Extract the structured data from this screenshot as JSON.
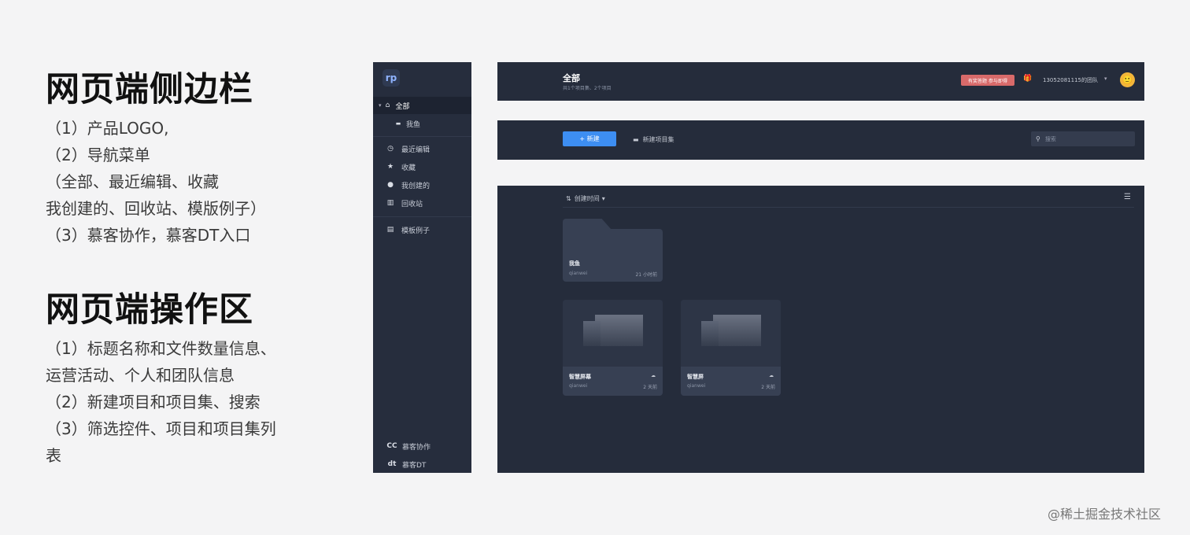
{
  "annotations": {
    "sidebar": {
      "title": "网页端侧边栏",
      "lines": [
        "（1）产品LOGO,",
        "（2）导航菜单",
        "（全部、最近编辑、收藏",
        "我创建的、回收站、模版例子）",
        "（3）慕客协作，慕客DT入口"
      ]
    },
    "operation": {
      "title": "网页端操作区",
      "lines": [
        "（1）标题名称和文件数量信息、",
        "运营活动、个人和团队信息",
        "（2）新建项目和项目集、搜索",
        "（3）筛选控件、项目和项目集列",
        "表"
      ]
    }
  },
  "sidebar": {
    "logo": "rp",
    "items": [
      {
        "label": "全部",
        "icon": "home-icon",
        "glyph": "⌂"
      },
      {
        "label": "我鱼",
        "icon": "folder-icon",
        "glyph": "▬"
      },
      {
        "label": "最近编辑",
        "icon": "clock-icon",
        "glyph": "◷"
      },
      {
        "label": "收藏",
        "icon": "star-icon",
        "glyph": "★"
      },
      {
        "label": "我创建的",
        "icon": "user-icon",
        "glyph": "●"
      },
      {
        "label": "回收站",
        "icon": "trash-icon",
        "glyph": "▥"
      },
      {
        "label": "模板例子",
        "icon": "template-icon",
        "glyph": "▤"
      }
    ],
    "footer": [
      {
        "label": "慕客协作",
        "icon": "cc-logo-icon",
        "glyph": "CC"
      },
      {
        "label": "慕客DT",
        "icon": "dt-logo-icon",
        "glyph": "dt"
      }
    ]
  },
  "header": {
    "title": "全部",
    "subtitle": "共1个项目集、2个项目",
    "promo": "有奖答题 参与即得",
    "team": "13052081115的团队"
  },
  "toolbar": {
    "new_button": "+ 新建",
    "new_set": "新建项目集",
    "search_placeholder": "搜索"
  },
  "content": {
    "sort_label": "创建时间",
    "folder": {
      "name": "我鱼",
      "owner": "qianwei",
      "time": "21 小时前"
    },
    "projects": [
      {
        "name": "智慧屏幕",
        "owner": "qianwei",
        "time": "2 天前"
      },
      {
        "name": "智慧屏",
        "owner": "qianwei",
        "time": "2 天前"
      }
    ]
  },
  "watermark": "@稀土掘金技术社区"
}
